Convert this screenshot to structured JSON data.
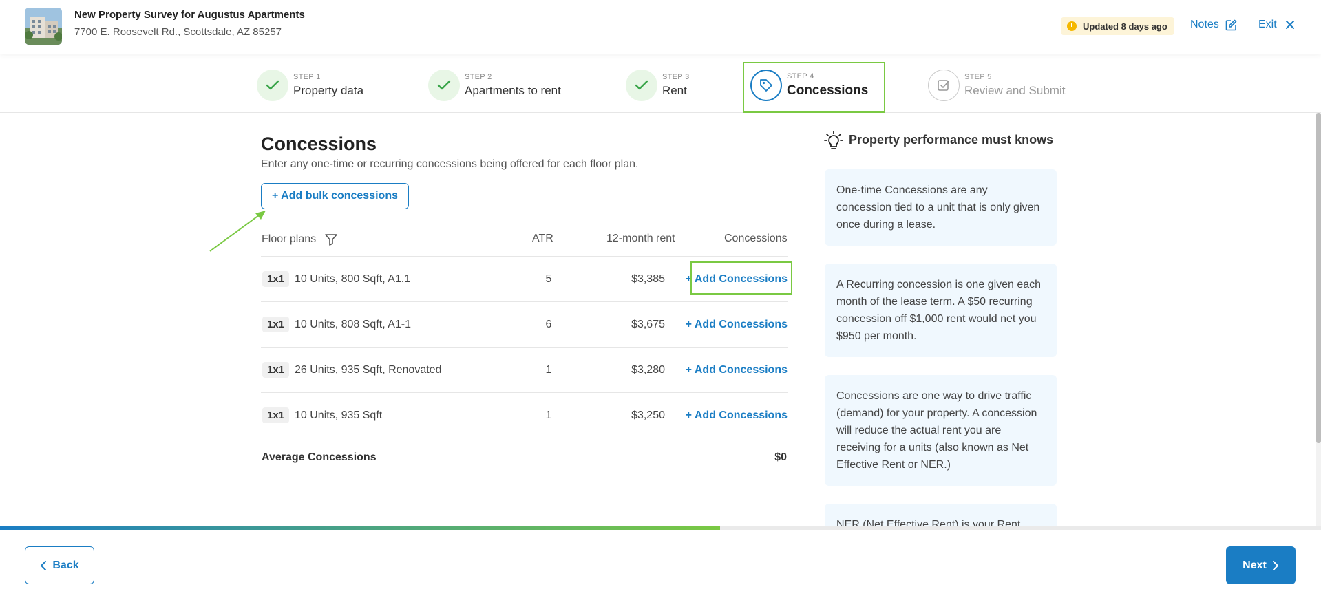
{
  "header": {
    "title": "New Property Survey for Augustus Apartments",
    "address": "7700 E. Roosevelt Rd., Scottsdale, AZ 85257",
    "updated_badge": "Updated 8 days ago",
    "notes_label": "Notes",
    "exit_label": "Exit"
  },
  "stepper": {
    "steps": [
      {
        "step": "STEP 1",
        "label": "Property data",
        "status": "done"
      },
      {
        "step": "STEP 2",
        "label": "Apartments to rent",
        "status": "done"
      },
      {
        "step": "STEP 3",
        "label": "Rent",
        "status": "done"
      },
      {
        "step": "STEP 4",
        "label": "Concessions",
        "status": "active"
      },
      {
        "step": "STEP 5",
        "label": "Review and Submit",
        "status": "future"
      }
    ]
  },
  "main": {
    "title": "Concessions",
    "subtitle": "Enter any one-time or recurring concessions being offered for each floor plan.",
    "bulk_button": "+ Add bulk concessions",
    "columns": {
      "floor_plans": "Floor plans",
      "atr": "ATR",
      "rent": "12-month rent",
      "concessions": "Concessions"
    },
    "rows": [
      {
        "tag": "1x1",
        "desc": "10 Units, 800 Sqft, A1.1",
        "atr": "5",
        "rent": "$3,385",
        "action": "+ Add Concessions"
      },
      {
        "tag": "1x1",
        "desc": "10 Units, 808 Sqft, A1-1",
        "atr": "6",
        "rent": "$3,675",
        "action": "+ Add Concessions"
      },
      {
        "tag": "1x1",
        "desc": "26 Units, 935 Sqft, Renovated",
        "atr": "1",
        "rent": "$3,280",
        "action": "+ Add Concessions"
      },
      {
        "tag": "1x1",
        "desc": "10 Units, 935 Sqft",
        "atr": "1",
        "rent": "$3,250",
        "action": "+ Add Concessions"
      }
    ],
    "average_label": "Average Concessions",
    "average_value": "$0"
  },
  "sidebar": {
    "title": "Property performance must knows",
    "tips": [
      "One-time Concessions are any concession tied to a unit that is only given once during a lease.",
      "A Recurring concession is one given each month of the lease term. A $50 recurring concession off $1,000 rent would net you $950 per month.",
      "Concessions are one way to drive traffic (demand) for your property. A concession will reduce the actual rent you are receiving for a units (also known as Net Effective Rent or NER.)",
      "NER (Net Effective Rent) is your Rent"
    ]
  },
  "progress": {
    "fraction": 0.545
  },
  "footer": {
    "back_label": "Back",
    "next_label": "Next"
  },
  "colors": {
    "accent": "#1a7dc4",
    "success": "#7ac943",
    "tip_bg": "#f0f8fe"
  },
  "icons": {
    "check": "check-icon",
    "tag": "tag-icon",
    "review": "checkbox-edit-icon",
    "bulb": "lightbulb-icon",
    "filter": "filter-icon"
  }
}
